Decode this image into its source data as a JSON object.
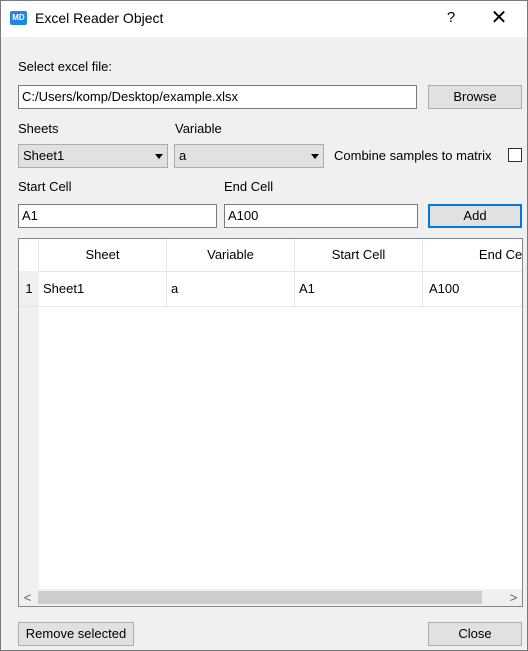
{
  "window": {
    "icon_text": "MD",
    "title": "Excel Reader Object",
    "help_label": "?",
    "close_label": "✕"
  },
  "file": {
    "label": "Select excel file:",
    "path": "C:/Users/komp/Desktop/example.xlsx",
    "browse_label": "Browse"
  },
  "sheets": {
    "label": "Sheets",
    "selected": "Sheet1"
  },
  "variable": {
    "label": "Variable",
    "selected": "a"
  },
  "combine": {
    "label": "Combine samples to matrix",
    "checked": false
  },
  "start_cell": {
    "label": "Start Cell",
    "value": "A1"
  },
  "end_cell": {
    "label": "End Cell",
    "value": "A100"
  },
  "add_label": "Add",
  "table": {
    "columns": [
      "Sheet",
      "Variable",
      "Start Cell",
      "End Cell"
    ],
    "rows": [
      {
        "num": "1",
        "sheet": "Sheet1",
        "variable": "a",
        "start": "A1",
        "end": "A100"
      }
    ]
  },
  "scroll": {
    "left_arrow": "<",
    "right_arrow": ">"
  },
  "remove_label": "Remove selected",
  "close_button_label": "Close"
}
